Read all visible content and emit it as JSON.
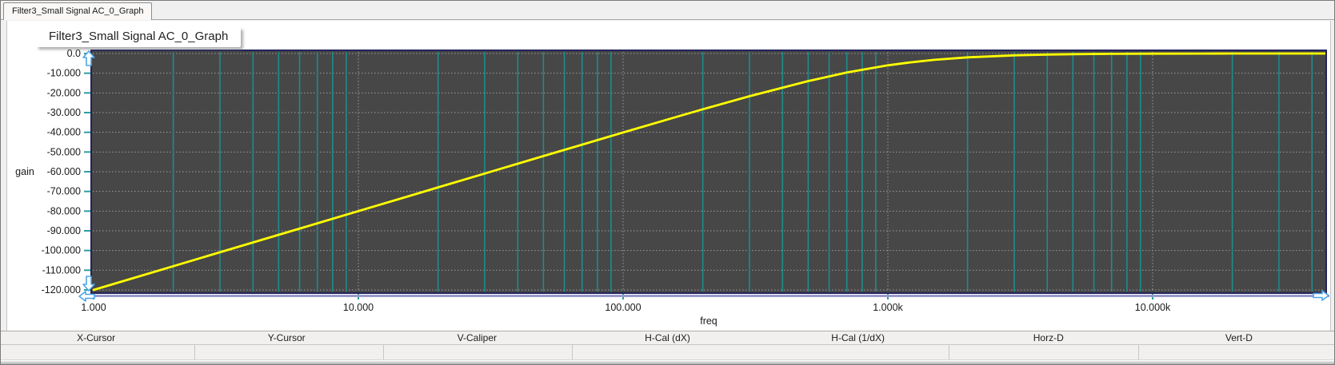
{
  "tab": {
    "label": "Filter3_Small Signal AC_0_Graph"
  },
  "chart_data": {
    "type": "line",
    "title": "Filter3_Small Signal AC_0_Graph",
    "xlabel": "freq",
    "ylabel": "gain",
    "x_scale": "log",
    "x_range": [
      1,
      45000
    ],
    "y_range": [
      -120,
      0
    ],
    "grid": "teal minor verticals, dotted decade verticals and dotted horizontals on dark background",
    "legend": "none",
    "x_ticks": [
      {
        "value": 1,
        "label": "1.000"
      },
      {
        "value": 10,
        "label": "10.000"
      },
      {
        "value": 100,
        "label": "100.000"
      },
      {
        "value": 1000,
        "label": "1.000k"
      },
      {
        "value": 10000,
        "label": "10.000k"
      }
    ],
    "y_ticks": [
      {
        "value": 0,
        "label": "0.0"
      },
      {
        "value": -10,
        "label": "-10.000"
      },
      {
        "value": -20,
        "label": "-20.000"
      },
      {
        "value": -30,
        "label": "-30.000"
      },
      {
        "value": -40,
        "label": "-40.000"
      },
      {
        "value": -50,
        "label": "-50.000"
      },
      {
        "value": -60,
        "label": "-60.000"
      },
      {
        "value": -70,
        "label": "-70.000"
      },
      {
        "value": -80,
        "label": "-80.000"
      },
      {
        "value": -90,
        "label": "-90.000"
      },
      {
        "value": -100,
        "label": "-100.000"
      },
      {
        "value": -110,
        "label": "-110.000"
      },
      {
        "value": -120,
        "label": "-120.000"
      }
    ],
    "series": [
      {
        "name": "gain",
        "color": "#ffff00",
        "points": [
          [
            1,
            -120.0
          ],
          [
            1.5,
            -112.96
          ],
          [
            2,
            -107.96
          ],
          [
            3,
            -100.92
          ],
          [
            5,
            -92.04
          ],
          [
            7,
            -86.2
          ],
          [
            10,
            -80.0
          ],
          [
            15,
            -72.96
          ],
          [
            20,
            -67.96
          ],
          [
            30,
            -60.93
          ],
          [
            50,
            -52.06
          ],
          [
            70,
            -46.24
          ],
          [
            100,
            -40.09
          ],
          [
            150,
            -33.15
          ],
          [
            200,
            -28.3
          ],
          [
            300,
            -21.67
          ],
          [
            500,
            -13.98
          ],
          [
            700,
            -9.66
          ],
          [
            1000,
            -6.02
          ],
          [
            1200,
            -4.58
          ],
          [
            1500,
            -3.2
          ],
          [
            2000,
            -1.94
          ],
          [
            3000,
            -0.92
          ],
          [
            4000,
            -0.53
          ],
          [
            5000,
            -0.34
          ],
          [
            7000,
            -0.17
          ],
          [
            10000,
            -0.09
          ],
          [
            15000,
            -0.04
          ],
          [
            20000,
            -0.02
          ],
          [
            30000,
            -0.01
          ],
          [
            45000,
            -0.005
          ]
        ]
      }
    ]
  },
  "plot_markers": [
    {
      "icon": "scroll-up-arrow-icon",
      "edge": "top-left"
    },
    {
      "icon": "scroll-down-arrow-icon",
      "edge": "bottom-left"
    },
    {
      "icon": "scroll-left-arrow-icon",
      "edge": "bottom-left-outside"
    },
    {
      "icon": "scroll-right-arrow-icon",
      "edge": "bottom-right"
    }
  ],
  "toolbar": {
    "headers": [
      "X-Cursor",
      "Y-Cursor",
      "V-Caliper",
      "H-Cal (dX)",
      "H-Cal (1/dX)",
      "Horz-D",
      "Vert-D"
    ]
  },
  "status_cells": [
    "",
    "",
    "",
    "",
    "",
    ""
  ],
  "colors": {
    "plot_bg": "#474747",
    "grid_teal": "#1d8c8c",
    "grid_dotted": "#9b9b9b",
    "tick_teal": "#2aa0a0",
    "trace_yellow": "#ffff00",
    "plot_border": "#23235e",
    "axis_underline": "#9a9acc",
    "marker_blue": "#4da3e8",
    "label_text": "#1a1a1a"
  }
}
